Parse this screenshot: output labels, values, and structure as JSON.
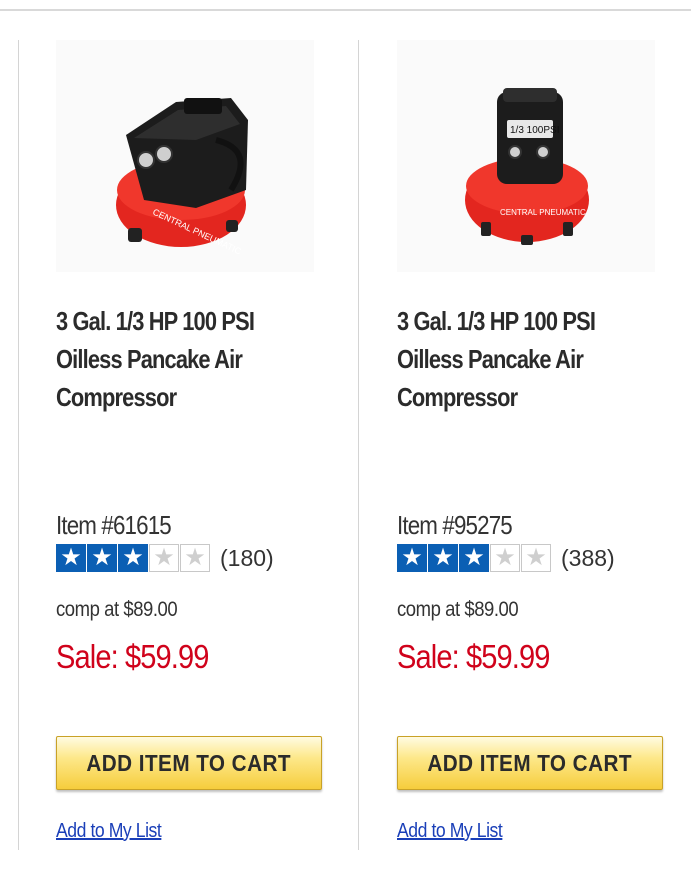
{
  "products": [
    {
      "title_lines": [
        "3 Gal. 1/3 HP 100 PSI",
        "Oilless Pancake Air",
        "Compressor"
      ],
      "item_number": "Item #61615",
      "rating_stars": 3,
      "rating_max": 5,
      "review_count": "(180)",
      "comp_price": "comp at $89.00",
      "sale_price": "Sale: $59.99",
      "cart_label": "ADD ITEM TO CART",
      "list_label": "Add to My List"
    },
    {
      "title_lines": [
        "3 Gal. 1/3 HP 100 PSI",
        "Oilless Pancake Air",
        "Compressor"
      ],
      "item_number": "Item #95275",
      "rating_stars": 3,
      "rating_max": 5,
      "review_count": "(388)",
      "comp_price": "comp at $89.00",
      "sale_price": "Sale: $59.99",
      "cart_label": "ADD ITEM TO CART",
      "list_label": "Add to My List"
    }
  ],
  "colors": {
    "sale_red": "#d0021b",
    "star_blue": "#0b5fb4",
    "link_blue": "#1a3fb8",
    "button_gold": "#f6cd3c"
  }
}
